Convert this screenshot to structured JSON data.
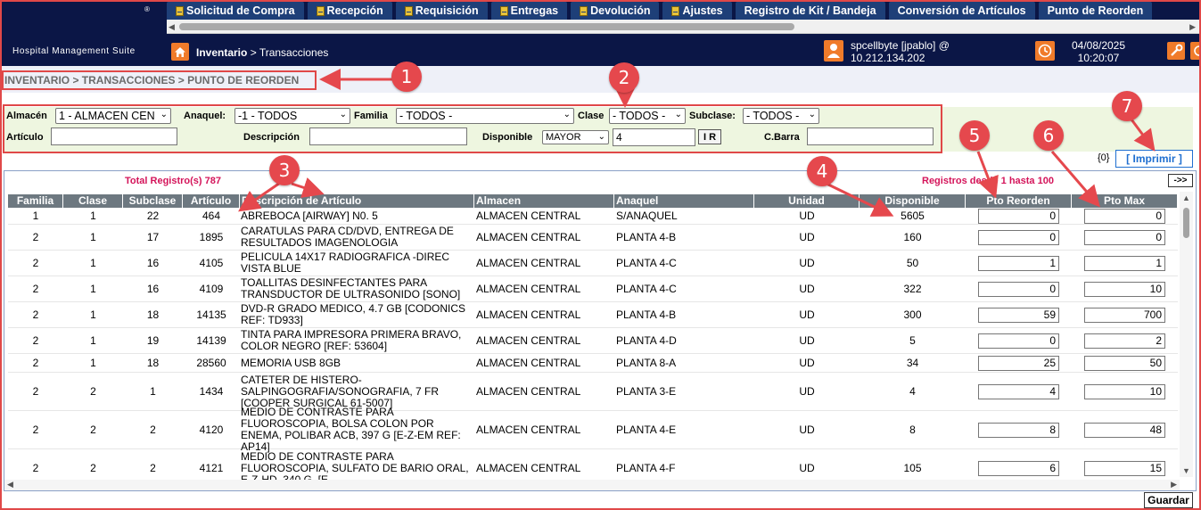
{
  "header": {
    "brand": "Hospital Management Suite",
    "reg_mark": "®",
    "menu": [
      "Solicitud de Compra",
      "Recepción",
      "Requisición",
      "Entregas",
      "Devolución",
      "Ajustes",
      "Registro de Kit / Bandeja",
      "Conversión de Artículos",
      "Punto de Reorden"
    ],
    "menu_with_icon": [
      true,
      true,
      true,
      true,
      true,
      true,
      false,
      false,
      false
    ],
    "breadcrumb_strong": "Inventario",
    "breadcrumb_rest": " > Transacciones",
    "user_line1": "spcellbyte [jpablo] @",
    "user_line2": "10.212.134.202",
    "date": "04/08/2025",
    "time": "10:20:07"
  },
  "section_title": "INVENTARIO > TRANSACCIONES > PUNTO DE REORDEN",
  "filters": {
    "almacen_label": "Almacén",
    "almacen_value": "1 - ALMACEN CEN",
    "anaquel_label": "Anaquel:",
    "anaquel_value": "-1 - TODOS",
    "familia_label": "Familia",
    "familia_value": "- TODOS -",
    "clase_label": "Clase",
    "clase_value": "- TODOS -",
    "subclase_label": "Subclase:",
    "subclase_value": "- TODOS -",
    "articulo_label": "Artículo",
    "articulo_value": "",
    "descripcion_label": "Descripción",
    "descripcion_value": "",
    "disponible_label": "Disponible",
    "disponible_op": "MAYOR",
    "disponible_value": "4",
    "ir_label": "I R",
    "cbarra_label": "C.Barra",
    "cbarra_value": ""
  },
  "count_zero": "{0}",
  "print_label": "[ Imprimir ]",
  "grid": {
    "total_label": "Total Registro(s) 787",
    "range_label": "Registros desde 1 hasta 100",
    "next_label": "->>",
    "columns": [
      "Familia",
      "Clase",
      "Subclase",
      "Artículo",
      "Descripción de Artículo",
      "Almacen",
      "Anaquel",
      "Unidad",
      "Disponible",
      "Pto Reorden",
      "Pto Max"
    ],
    "rows": [
      {
        "familia": "1",
        "clase": "1",
        "subclase": "22",
        "articulo": "464",
        "descripcion": "ABREBOCA [AIRWAY] N0. 5",
        "almacen": "ALMACEN CENTRAL",
        "anaquel": "S/ANAQUEL",
        "unidad": "UD",
        "disponible": "5605",
        "reorden": "0",
        "max": "0"
      },
      {
        "familia": "2",
        "clase": "1",
        "subclase": "17",
        "articulo": "1895",
        "descripcion": "CARATULAS PARA CD/DVD, ENTREGA DE RESULTADOS IMAGENOLOGIA",
        "almacen": "ALMACEN CENTRAL",
        "anaquel": "PLANTA 4-B",
        "unidad": "UD",
        "disponible": "160",
        "reorden": "0",
        "max": "0"
      },
      {
        "familia": "2",
        "clase": "1",
        "subclase": "16",
        "articulo": "4105",
        "descripcion": "PELICULA 14X17 RADIOGRAFICA -DIREC VISTA BLUE",
        "almacen": "ALMACEN CENTRAL",
        "anaquel": "PLANTA 4-C",
        "unidad": "UD",
        "disponible": "50",
        "reorden": "1",
        "max": "1"
      },
      {
        "familia": "2",
        "clase": "1",
        "subclase": "16",
        "articulo": "4109",
        "descripcion": "TOALLITAS DESINFECTANTES PARA TRANSDUCTOR DE ULTRASONIDO [SONO]",
        "almacen": "ALMACEN CENTRAL",
        "anaquel": "PLANTA 4-C",
        "unidad": "UD",
        "disponible": "322",
        "reorden": "0",
        "max": "10"
      },
      {
        "familia": "2",
        "clase": "1",
        "subclase": "18",
        "articulo": "14135",
        "descripcion": "DVD-R GRADO MEDICO, 4.7 GB [CODONICS REF: TD933]",
        "almacen": "ALMACEN CENTRAL",
        "anaquel": "PLANTA 4-B",
        "unidad": "UD",
        "disponible": "300",
        "reorden": "59",
        "max": "700"
      },
      {
        "familia": "2",
        "clase": "1",
        "subclase": "19",
        "articulo": "14139",
        "descripcion": "TINTA PARA IMPRESORA PRIMERA BRAVO, COLOR NEGRO [REF: 53604]",
        "almacen": "ALMACEN CENTRAL",
        "anaquel": "PLANTA 4-D",
        "unidad": "UD",
        "disponible": "5",
        "reorden": "0",
        "max": "2"
      },
      {
        "familia": "2",
        "clase": "1",
        "subclase": "18",
        "articulo": "28560",
        "descripcion": "MEMORIA USB 8GB",
        "almacen": "ALMACEN CENTRAL",
        "anaquel": "PLANTA 8-A",
        "unidad": "UD",
        "disponible": "34",
        "reorden": "25",
        "max": "50"
      },
      {
        "familia": "2",
        "clase": "2",
        "subclase": "1",
        "articulo": "1434",
        "descripcion": "CATETER DE HISTERO-SALPINGOGRAFIA/SONOGRAFIA, 7 FR [COOPER SURGICAL 61-5007]",
        "almacen": "ALMACEN CENTRAL",
        "anaquel": "PLANTA 3-E",
        "unidad": "UD",
        "disponible": "4",
        "reorden": "4",
        "max": "10"
      },
      {
        "familia": "2",
        "clase": "2",
        "subclase": "2",
        "articulo": "4120",
        "descripcion": "MEDIO DE CONTRASTE PARA FLUOROSCOPIA, BOLSA COLON POR ENEMA, POLIBAR ACB, 397 G [E-Z-EM REF: AP14]",
        "almacen": "ALMACEN CENTRAL",
        "anaquel": "PLANTA 4-E",
        "unidad": "UD",
        "disponible": "8",
        "reorden": "8",
        "max": "48"
      },
      {
        "familia": "2",
        "clase": "2",
        "subclase": "2",
        "articulo": "4121",
        "descripcion": "MEDIO DE CONTRASTE PARA FLUOROSCOPIA, SULFATO DE BARIO ORAL, E-Z-HD, 340 G. [E-",
        "almacen": "ALMACEN CENTRAL",
        "anaquel": "PLANTA 4-F",
        "unidad": "UD",
        "disponible": "105",
        "reorden": "6",
        "max": "15"
      }
    ]
  },
  "save_label": "Guardar",
  "annotations": [
    "1",
    "2",
    "3",
    "4",
    "5",
    "6",
    "7"
  ],
  "colors": {
    "header_bg": "#0b1646",
    "menu_tab": "#1e3f78",
    "accent_orange": "#f07b2a",
    "annotation_red": "#e5484d",
    "highlight_text": "#d4145a",
    "grid_header": "#6d7880",
    "filter_bg": "#eef6e0"
  }
}
